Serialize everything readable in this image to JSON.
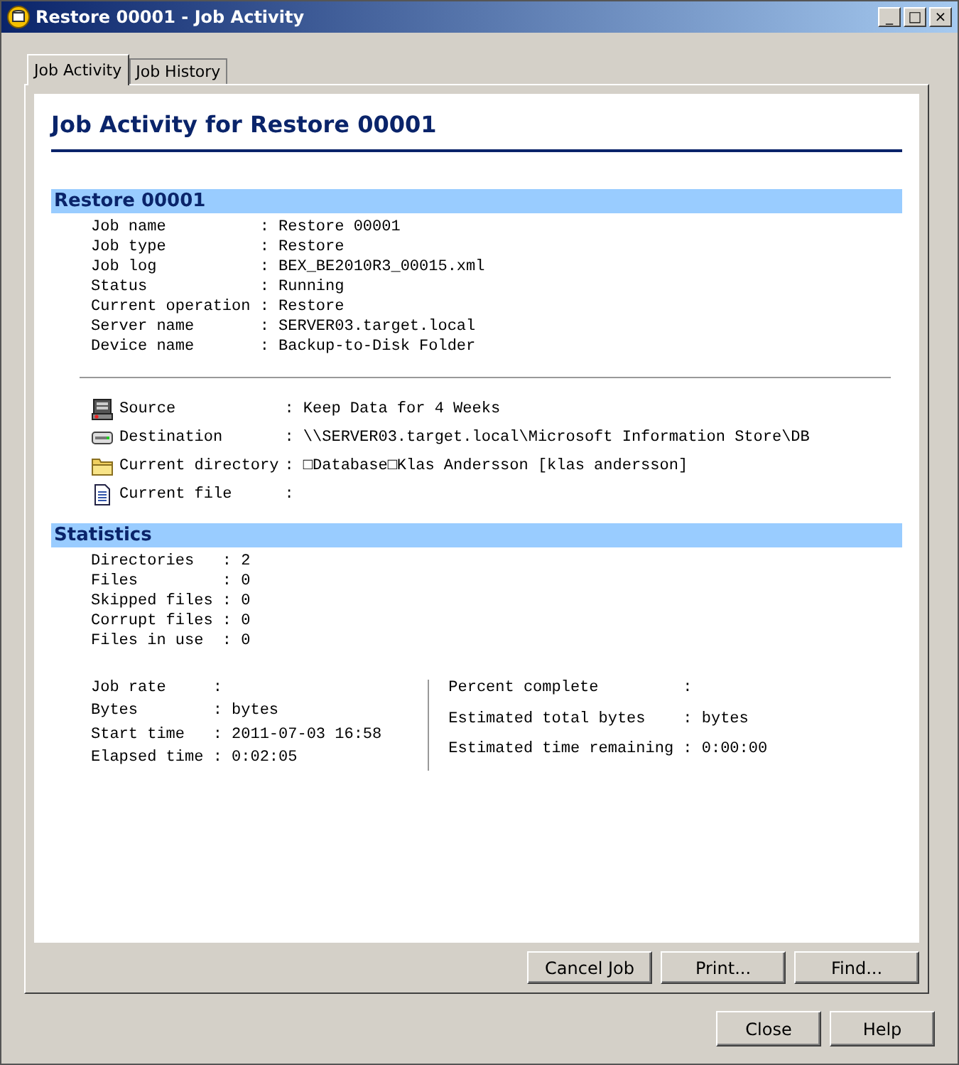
{
  "window": {
    "title": "Restore 00001 - Job Activity",
    "controls": [
      "_",
      "□",
      "×"
    ]
  },
  "tabs": [
    {
      "label": "Job Activity",
      "selected": true
    },
    {
      "label": "Job History",
      "selected": false
    }
  ],
  "heading": "Job Activity for Restore 00001",
  "job_section": {
    "title": "Restore 00001",
    "fields": [
      {
        "label": "Job name",
        "value": ": Restore 00001"
      },
      {
        "label": "Job type",
        "value": ": Restore"
      },
      {
        "label": "Job log",
        "value": ": BEX_BE2010R3_00015.xml"
      },
      {
        "label": "Status",
        "value": ": Running"
      },
      {
        "label": "Current operation",
        "value": ": Restore"
      },
      {
        "label": "Server name",
        "value": ": SERVER03.target.local"
      },
      {
        "label": "Device name",
        "value": ": Backup-to-Disk Folder"
      }
    ],
    "locations": [
      {
        "kind": "server",
        "label": "Source",
        "value": ": Keep Data for 4 Weeks"
      },
      {
        "kind": "drive",
        "label": "Destination",
        "value": ": \\\\SERVER03.target.local\\Microsoft Information Store\\DB"
      },
      {
        "kind": "folder",
        "label": "Current directory",
        "value": ": □Database□Klas Andersson [klas andersson]"
      },
      {
        "kind": "file",
        "label": "Current file",
        "value": ":"
      }
    ]
  },
  "statistics": {
    "title": "Statistics",
    "counts": [
      {
        "label": "Directories",
        "value": ": 2"
      },
      {
        "label": "Files",
        "value": ": 0"
      },
      {
        "label": "Skipped files",
        "value": ": 0"
      },
      {
        "label": "Corrupt files",
        "value": ": 0"
      },
      {
        "label": "Files in use",
        "value": ": 0"
      }
    ],
    "left": [
      {
        "label": "Job rate",
        "value": ":"
      },
      {
        "label": "Bytes",
        "value": ":  bytes"
      },
      {
        "label": "Start time",
        "value": ": 2011-07-03 16:58"
      },
      {
        "label": "Elapsed time",
        "value": ": 0:02:05"
      }
    ],
    "right": [
      {
        "label": "Percent complete",
        "value": ":"
      },
      {
        "label": "Estimated total bytes",
        "value": ":  bytes"
      },
      {
        "label": "Estimated time remaining",
        "value": ": 0:00:00"
      }
    ]
  },
  "panel_buttons": [
    "Cancel Job",
    "Print...",
    "Find..."
  ],
  "dialog_buttons": [
    "Close",
    "Help"
  ]
}
